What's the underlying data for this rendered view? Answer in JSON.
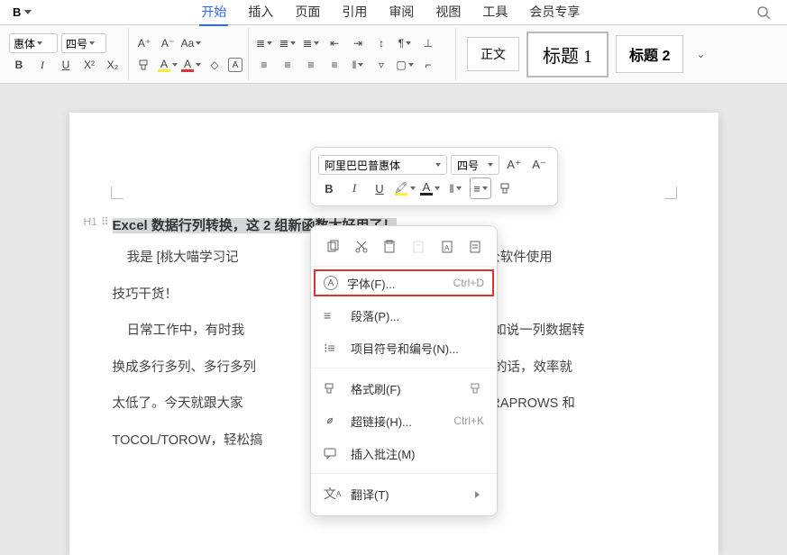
{
  "topbar": {
    "b_label": "B"
  },
  "menu": {
    "tabs": [
      "开始",
      "插入",
      "页面",
      "引用",
      "审阅",
      "视图",
      "工具",
      "会员专享"
    ],
    "active": 0
  },
  "ribbon": {
    "font_family": "惠体",
    "font_size": "四号",
    "styles": {
      "body": "正文",
      "h1": "标题 1",
      "h2": "标题 2"
    }
  },
  "mini": {
    "font_family": "阿里巴巴普惠体",
    "font_size": "四号",
    "btns": {
      "inc": "A⁺",
      "dec": "A⁻",
      "bold": "B",
      "italic": "I",
      "underline": "U"
    }
  },
  "context": {
    "icons": [
      "copy",
      "cut",
      "paste",
      "paste-as-text",
      "paste-style",
      "paste-formula"
    ],
    "items": [
      {
        "icon": "A",
        "label": "字体(F)...",
        "shortcut": "Ctrl+D",
        "highlight": true
      },
      {
        "icon": "para",
        "label": "段落(P)..."
      },
      {
        "icon": "list",
        "label": "项目符号和编号(N)..."
      },
      {
        "sep": true
      },
      {
        "icon": "brush",
        "label": "格式刷(F)",
        "ext": "brush"
      },
      {
        "icon": "link",
        "label": "超链接(H)...",
        "shortcut": "Ctrl+K"
      },
      {
        "icon": "comment",
        "label": "插入批注(M)"
      },
      {
        "sep": true
      },
      {
        "icon": "translate",
        "label": "翻译(T)",
        "ext": "chev"
      }
    ]
  },
  "doc": {
    "side_h1": "H1",
    "title": "Excel 数据行列转换，这 2 组新函数太好用了！",
    "p1_a": "我是 [桃大喵学习记",
    "p1_b": "分享职场办公软件使用",
    "p2": "技巧干货！",
    "p3_a": "日常工作中，有时我",
    "p3_b": "转换，比如说一列数据转",
    "p4_a": "换成多行多列、多行多列",
    "p4_b": "手动复制的话，效率就",
    "p5_a": "太低了。今天就跟大家",
    "p5_b": "PCOLS/WRAPROWS 和",
    "p6_a": "TOCOL/TOROW，轻松搞"
  }
}
